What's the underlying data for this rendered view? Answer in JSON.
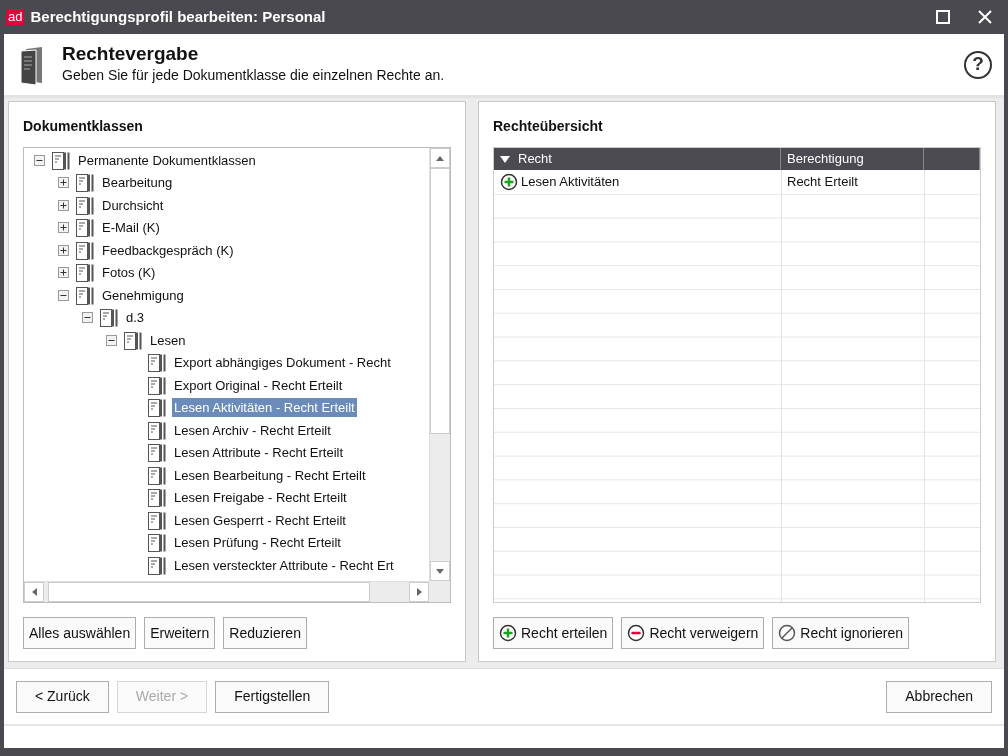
{
  "window": {
    "logo": "ad",
    "title": "Berechtigungsprofil bearbeiten: Personal"
  },
  "header": {
    "title": "Rechtevergabe",
    "subtitle": "Geben Sie für jede Dokumentklasse die einzelnen Rechte an.",
    "help": "?"
  },
  "left_panel": {
    "title": "Dokumentklassen",
    "tree": [
      {
        "label": "Permanente Dokumentklassen",
        "expanded": true,
        "selected": false,
        "children": [
          {
            "label": "Bearbeitung",
            "expanded": false,
            "selected": false
          },
          {
            "label": "Durchsicht",
            "expanded": false,
            "selected": false
          },
          {
            "label": "E-Mail (K)",
            "expanded": false,
            "selected": false
          },
          {
            "label": "Feedbackgespräch (K)",
            "expanded": false,
            "selected": false
          },
          {
            "label": "Fotos (K)",
            "expanded": false,
            "selected": false
          },
          {
            "label": "Genehmigung",
            "expanded": true,
            "selected": false,
            "children": [
              {
                "label": "d.3",
                "expanded": true,
                "selected": false,
                "children": [
                  {
                    "label": "Lesen",
                    "expanded": true,
                    "selected": false,
                    "children": [
                      {
                        "label": "Export abhängiges Dokument - Recht",
                        "selected": false
                      },
                      {
                        "label": "Export Original - Recht Erteilt",
                        "selected": false
                      },
                      {
                        "label": "Lesen Aktivitäten - Recht Erteilt",
                        "selected": true
                      },
                      {
                        "label": "Lesen Archiv - Recht Erteilt",
                        "selected": false
                      },
                      {
                        "label": "Lesen Attribute - Recht Erteilt",
                        "selected": false
                      },
                      {
                        "label": "Lesen Bearbeitung - Recht Erteilt",
                        "selected": false
                      },
                      {
                        "label": "Lesen Freigabe - Recht Erteilt",
                        "selected": false
                      },
                      {
                        "label": "Lesen Gesperrt - Recht Erteilt",
                        "selected": false
                      },
                      {
                        "label": "Lesen Prüfung - Recht Erteilt",
                        "selected": false
                      },
                      {
                        "label": "Lesen versteckter Attribute - Recht Ert",
                        "selected": false
                      }
                    ]
                  }
                ]
              }
            ]
          }
        ]
      }
    ],
    "buttons": [
      {
        "label": "Alles auswählen"
      },
      {
        "label": "Erweitern"
      },
      {
        "label": "Reduzieren"
      }
    ]
  },
  "right_panel": {
    "title": "Rechteübersicht",
    "table": {
      "columns": [
        "Recht",
        "Berechtigung"
      ],
      "rows": [
        {
          "kind": "grant",
          "cells": [
            "Lesen Aktivitäten",
            "Recht Erteilt"
          ]
        }
      ]
    },
    "buttons": [
      {
        "label": "Recht erteilen",
        "kind": "grant"
      },
      {
        "label": "Recht verweigern",
        "kind": "deny"
      },
      {
        "label": "Recht ignorieren",
        "kind": "ignore"
      }
    ]
  },
  "footer": {
    "buttons": [
      {
        "label": "< Zurück",
        "disabled": false
      },
      {
        "label": "Weiter >",
        "disabled": true
      },
      {
        "label": "Fertigstellen",
        "disabled": false
      }
    ],
    "cancel": {
      "label": "Abbrechen",
      "disabled": false
    }
  }
}
